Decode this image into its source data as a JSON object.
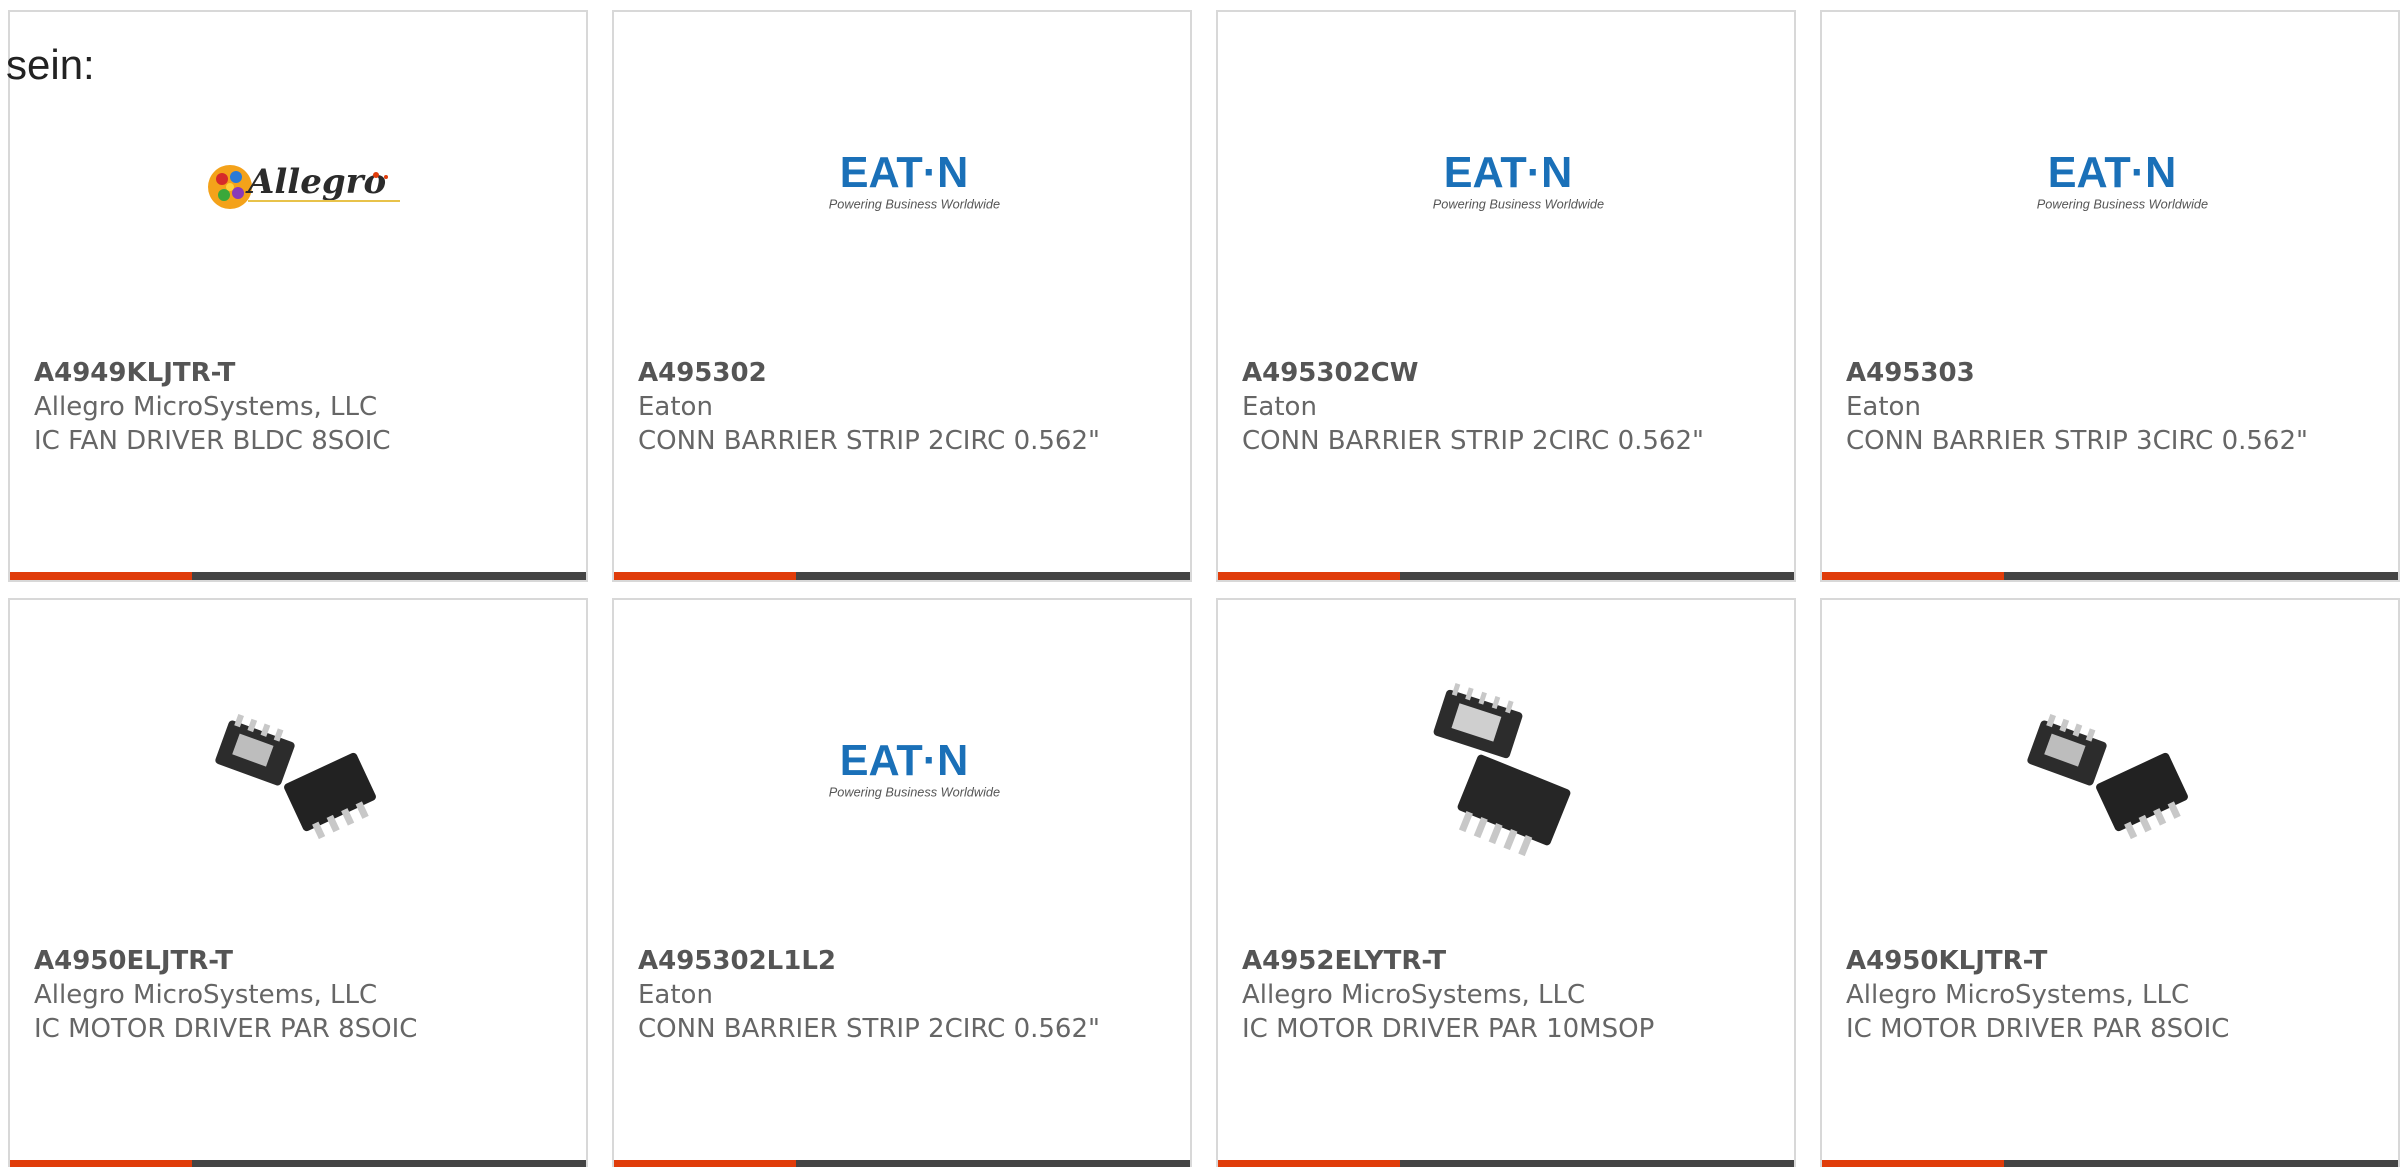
{
  "leading_text": "sein:",
  "colors": {
    "accent": "#e03c0a",
    "bar": "#444444",
    "eaton_blue": "#1a70b8",
    "border": "#d8d8d8"
  },
  "brand_logos": {
    "eaton_wordmark": "EAT·N",
    "eaton_tagline": "Powering Business Worldwide",
    "allegro_wordmark": "Allegro"
  },
  "products": [
    {
      "part": "A4949KLJTR-T",
      "manufacturer": "Allegro MicroSystems, LLC",
      "description": "IC FAN DRIVER BLDC 8SOIC",
      "image": "allegro-logo"
    },
    {
      "part": "A495302",
      "manufacturer": "Eaton",
      "description": "CONN BARRIER STRIP 2CIRC 0.562\"",
      "image": "eaton-logo"
    },
    {
      "part": "A495302CW",
      "manufacturer": "Eaton",
      "description": "CONN BARRIER STRIP 2CIRC 0.562\"",
      "image": "eaton-logo"
    },
    {
      "part": "A495303",
      "manufacturer": "Eaton",
      "description": "CONN BARRIER STRIP 3CIRC 0.562\"",
      "image": "eaton-logo"
    },
    {
      "part": "A4950ELJTR-T",
      "manufacturer": "Allegro MicroSystems, LLC",
      "description": "IC MOTOR DRIVER PAR 8SOIC",
      "image": "soic-chip-photo"
    },
    {
      "part": "A495302L1L2",
      "manufacturer": "Eaton",
      "description": "CONN BARRIER STRIP 2CIRC 0.562\"",
      "image": "eaton-logo"
    },
    {
      "part": "A4952ELYTR-T",
      "manufacturer": "Allegro MicroSystems, LLC",
      "description": "IC MOTOR DRIVER PAR 10MSOP",
      "image": "msop-chip-photo"
    },
    {
      "part": "A4950KLJTR-T",
      "manufacturer": "Allegro MicroSystems, LLC",
      "description": "IC MOTOR DRIVER PAR 8SOIC",
      "image": "soic-chip-photo"
    }
  ]
}
